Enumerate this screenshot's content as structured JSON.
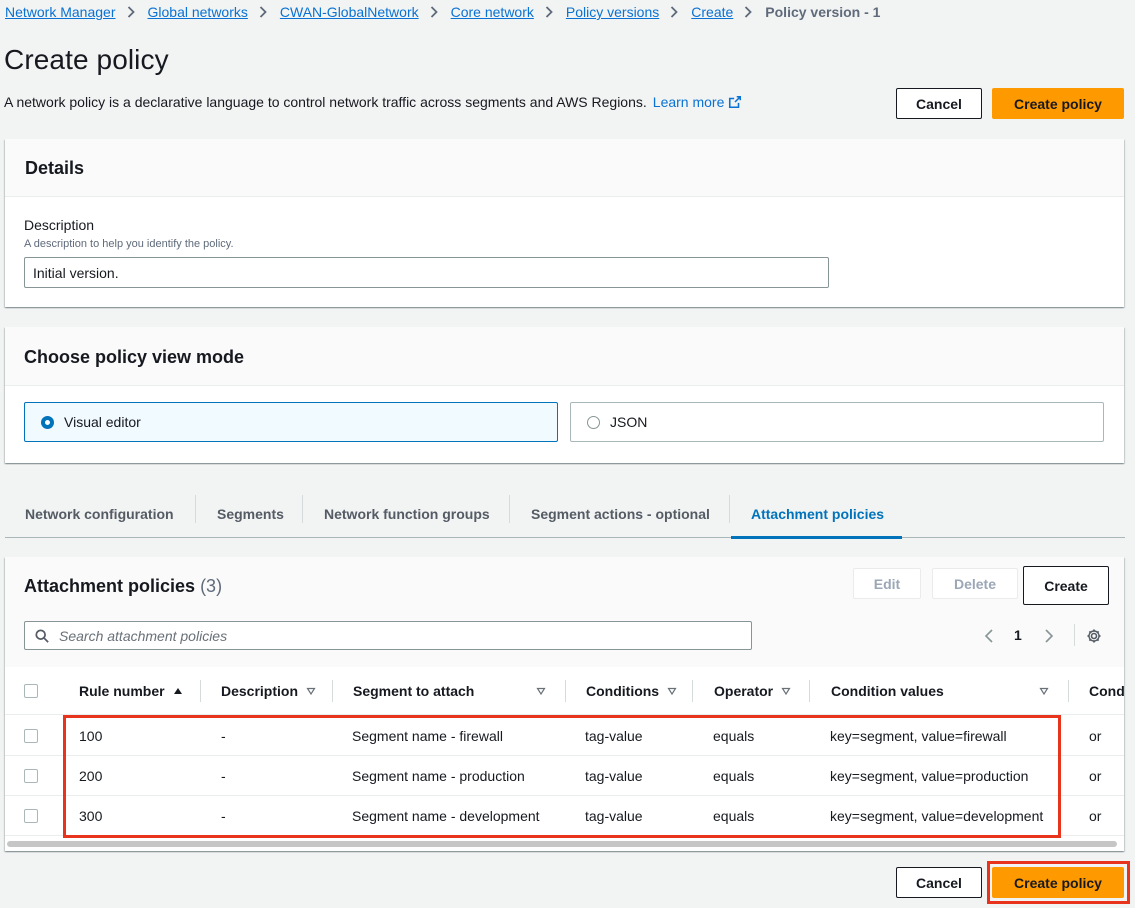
{
  "breadcrumb": {
    "items": [
      "Network Manager",
      "Global networks",
      "CWAN-GlobalNetwork",
      "Core network",
      "Policy versions",
      "Create"
    ],
    "current": "Policy version - 1"
  },
  "header": {
    "title": "Create policy",
    "description": "A network policy is a declarative language to control network traffic across segments and AWS Regions.",
    "learn_more": "Learn more",
    "cancel_label": "Cancel",
    "create_label": "Create policy"
  },
  "details": {
    "title": "Details",
    "description_label": "Description",
    "description_hint": "A description to help you identify the policy.",
    "description_value": "Initial version."
  },
  "view_mode": {
    "title": "Choose policy view mode",
    "options": [
      {
        "label": "Visual editor",
        "selected": true
      },
      {
        "label": "JSON",
        "selected": false
      }
    ]
  },
  "tabs": [
    {
      "label": "Network configuration",
      "active": false
    },
    {
      "label": "Segments",
      "active": false
    },
    {
      "label": "Network function groups",
      "active": false
    },
    {
      "label": "Segment actions - optional",
      "active": false
    },
    {
      "label": "Attachment policies",
      "active": true
    }
  ],
  "attachment_policies": {
    "title": "Attachment policies",
    "count": "(3)",
    "edit_label": "Edit",
    "delete_label": "Delete",
    "create_label": "Create",
    "search_placeholder": "Search attachment policies",
    "page": "1",
    "columns": [
      "Rule number",
      "Description",
      "Segment to attach",
      "Conditions",
      "Operator",
      "Condition values",
      "Cond"
    ],
    "rows": [
      [
        "100",
        "-",
        "Segment name - firewall",
        "tag-value",
        "equals",
        "key=segment, value=firewall",
        "or"
      ],
      [
        "200",
        "-",
        "Segment name - production",
        "tag-value",
        "equals",
        "key=segment, value=production",
        "or"
      ],
      [
        "300",
        "-",
        "Segment name - development",
        "tag-value",
        "equals",
        "key=segment, value=development",
        "or"
      ]
    ]
  },
  "footer": {
    "cancel_label": "Cancel",
    "create_label": "Create policy"
  },
  "colors": {
    "link": "#0972d3",
    "primary": "#ff9900",
    "active_tab": "#0073bb",
    "highlight": "#e8341c"
  }
}
